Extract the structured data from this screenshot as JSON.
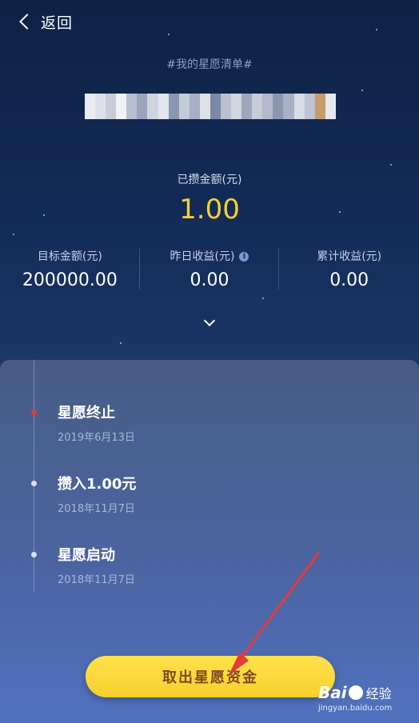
{
  "header": {
    "back_label": "返回",
    "back_icon": "chevron-left-icon"
  },
  "wishlist": {
    "title": "#我的星愿清单#",
    "name_mosaic_colors": [
      "#e9ebf1",
      "#dde0e7",
      "#c8ccd7",
      "#f1f2f5",
      "#b8bfd0",
      "#9aa4bd",
      "#cfd4de",
      "#e3e6ec",
      "#8b96b1",
      "#c4cad7",
      "#a7b0c4",
      "#dee1e8",
      "#7b88a6",
      "#b9c0cf",
      "#d2d6df",
      "#9ea7bc",
      "#c8ccd8",
      "#b2b9ca",
      "#8a95b0",
      "#a9b1c4",
      "#d8dce4",
      "#bec4d3",
      "#c69c6b",
      "#e4e7ed"
    ]
  },
  "saved": {
    "label": "已攒金额(元)",
    "value": "1.00",
    "color": "#f2d135"
  },
  "stats": [
    {
      "label": "目标金额(元)",
      "value": "200000.00"
    },
    {
      "label": "昨日收益(元)",
      "value": "0.00",
      "icon": "info-icon"
    },
    {
      "label": "累计收益(元)",
      "value": "0.00"
    }
  ],
  "timeline": [
    {
      "title": "星愿终止",
      "date": "2019年6月13日",
      "status": "active"
    },
    {
      "title": "攒入1.00元",
      "date": "2018年11月7日",
      "status": "done"
    },
    {
      "title": "星愿启动",
      "date": "2018年11月7日",
      "status": "done"
    }
  ],
  "actions": {
    "withdraw_label": "取出星愿资金",
    "accent": "#f8cf2c"
  },
  "watermark": {
    "brand": "Bai",
    "brand2": "经验",
    "site": "jingyan.baidu.com"
  }
}
